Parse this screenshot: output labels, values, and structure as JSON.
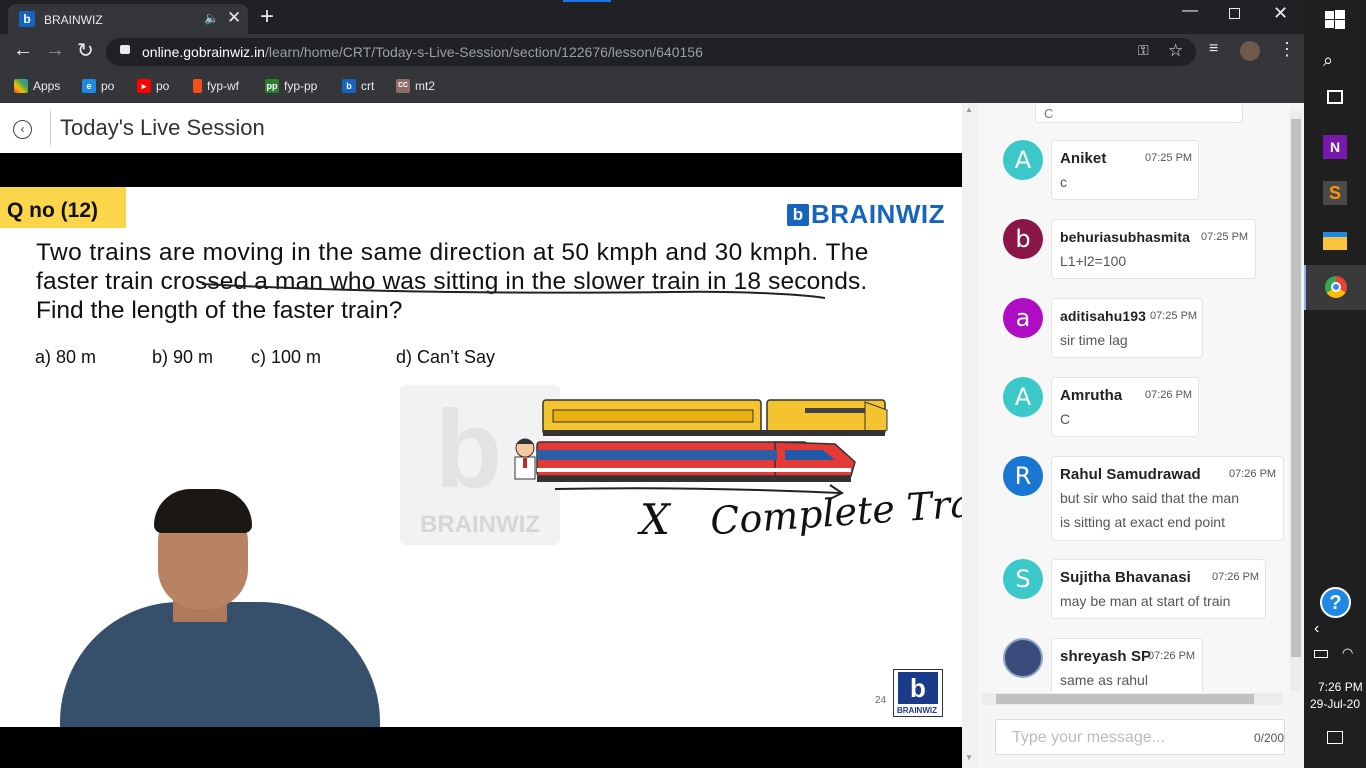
{
  "browser": {
    "tab_title": "BRAINWIZ",
    "url_host": "online.gobrainwiz.in",
    "url_path": "/learn/home/CRT/Today-s-Live-Session/section/122676/lesson/640156"
  },
  "bookmarks": [
    {
      "label": "Apps",
      "icon": "apps-grid-icon",
      "color": "#ea4335"
    },
    {
      "label": "po",
      "icon": "edge-icon",
      "color": "#1e88e5"
    },
    {
      "label": "po",
      "icon": "youtube-icon",
      "color": "#ff0000"
    },
    {
      "label": "fyp-wf",
      "icon": "figma-icon",
      "color": "#f24e1e"
    },
    {
      "label": "fyp-pp",
      "icon": "pp-icon",
      "color": "#2e7d32"
    },
    {
      "label": "crt",
      "icon": "brainwiz-icon",
      "color": "#1565c0"
    },
    {
      "label": "mt2",
      "icon": "cc-icon",
      "color": "#8d6e63"
    }
  ],
  "page": {
    "title": "Today's Live Session"
  },
  "slide": {
    "question_no": "Q no (12)",
    "brand": "BRAINWIZ",
    "question_line1": "Two trains are moving in the same direction at 50 kmph and 30 kmph. The",
    "question_line2": "faster train crossed a man who was sitting in the slower train in 18 seconds.",
    "question_line3": "Find the length of the faster train?",
    "options": [
      "a) 80 m",
      "b) 90 m",
      "c) 100 m",
      "d) Can’t Say"
    ],
    "watermark": "BRAINWIZ",
    "handwriting_mark": "X",
    "handwriting_text": "Complete Train",
    "page_number": "24",
    "logo_label": "BRAINWIZ"
  },
  "chat": {
    "partial_top_text": "C",
    "messages": [
      {
        "initial": "A",
        "name": "Aniket",
        "time": "07:25 PM",
        "text": "c",
        "color": "#3cc8c8"
      },
      {
        "initial": "b",
        "name": "behuriasubhasmita",
        "time": "07:25 PM",
        "text": "L1+l2=100",
        "color": "#8a1547"
      },
      {
        "initial": "a",
        "name": "aditisahu193",
        "time": "07:25 PM",
        "text": "sir time lag",
        "color": "#b00cc4"
      },
      {
        "initial": "A",
        "name": "Amrutha",
        "time": "07:26 PM",
        "text": "C",
        "color": "#3cc8c8"
      },
      {
        "initial": "R",
        "name": "Rahul Samudrawad",
        "time": "07:26 PM",
        "text": "but sir who said that the man",
        "text2": "is sitting at exact end point",
        "color": "#1976d2"
      },
      {
        "initial": "S",
        "name": "Sujitha Bhavanasi",
        "time": "07:26 PM",
        "text": "may be man at start of train",
        "color": "#3cc8c8"
      },
      {
        "initial": "",
        "name": "shreyash SP",
        "time": "07:26 PM",
        "text": "same as rahul",
        "color": "#3a4d7a"
      }
    ],
    "input_placeholder": "Type your message...",
    "char_count": "0/200"
  },
  "taskbar": {
    "time": "7:26 PM",
    "date": "29-Jul-20"
  }
}
